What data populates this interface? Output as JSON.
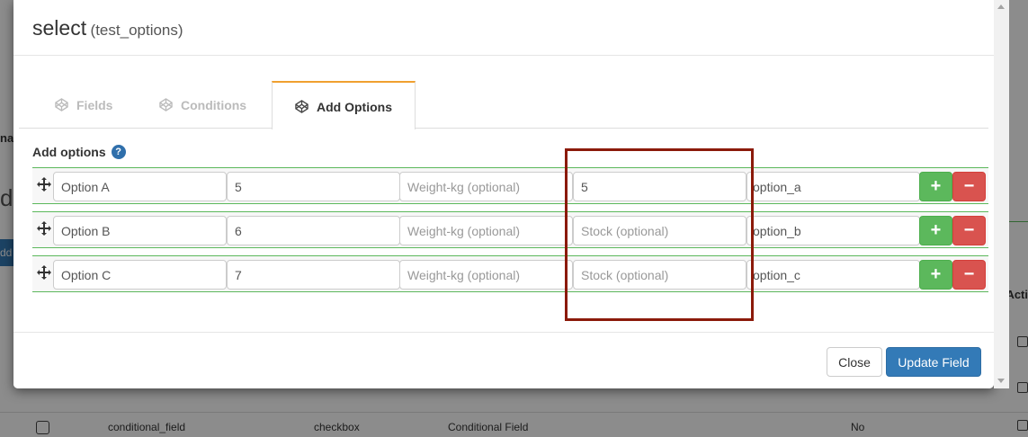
{
  "modal": {
    "title": "select",
    "subtitle": "(test_options)",
    "tabs": [
      {
        "label": "Fields",
        "active": false
      },
      {
        "label": "Conditions",
        "active": false
      },
      {
        "label": "Add Options",
        "active": true
      }
    ],
    "section_label": "Add options",
    "help_glyph": "?",
    "options": [
      {
        "name": "Option A",
        "price": "5",
        "weight": "",
        "stock": "5",
        "value": "option_a"
      },
      {
        "name": "Option B",
        "price": "6",
        "weight": "",
        "stock": "",
        "value": "option_b"
      },
      {
        "name": "Option C",
        "price": "7",
        "weight": "",
        "stock": "",
        "value": "option_c"
      }
    ],
    "placeholders": {
      "weight": "Weight-kg (optional)",
      "stock": "Stock (optional)"
    },
    "add_glyph": "+",
    "remove_glyph": "−",
    "footer": {
      "close_label": "Close",
      "update_label": "Update Field"
    }
  },
  "background": {
    "fragments": {
      "na": "na",
      "d": "d",
      "dd": "dd",
      "acti": "Acti"
    },
    "row": {
      "name": "conditional_field",
      "type": "checkbox",
      "label": "Conditional Field",
      "required": "No"
    }
  },
  "colors": {
    "accent_tab": "#f0a030",
    "primary": "#337ab7",
    "success": "#5cb85c",
    "danger": "#d9534f",
    "highlight": "#8b1a0a"
  },
  "icons": {
    "tab_icon": "codepen-icon",
    "drag": "move-arrows-icon"
  }
}
